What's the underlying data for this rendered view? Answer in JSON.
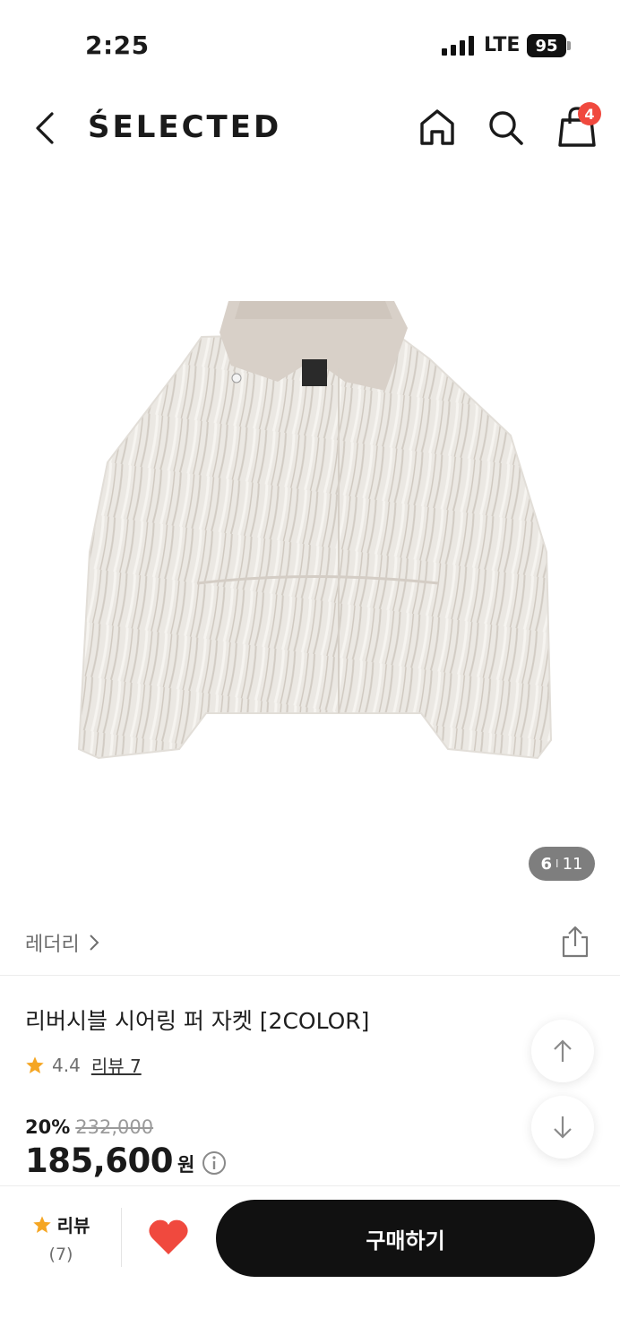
{
  "status_bar": {
    "time": "2:25",
    "network": "LTE",
    "battery": "95"
  },
  "header": {
    "brand": "ŚELECTED",
    "cart_count": "4"
  },
  "image_counter": {
    "current": "6",
    "separator": "I",
    "total": "11"
  },
  "product": {
    "brand": "레더리",
    "title": "리버시블 시어링 퍼 자켓 [2COLOR]",
    "rating": "4.4",
    "review_link": "리뷰 7",
    "discount_rate": "20%",
    "original_price": "232,000",
    "sale_price": "185,600",
    "currency": "원"
  },
  "bottom_bar": {
    "review_label": "리뷰",
    "review_count": "(7)",
    "buy_label": "구매하기"
  },
  "colors": {
    "accent": "#f0493e",
    "star": "#f5a623",
    "heart": "#f0493e",
    "button": "#111111"
  },
  "icons": [
    "back-icon",
    "home-icon",
    "search-icon",
    "shopping-bag-icon",
    "share-icon",
    "star-icon",
    "arrow-up-icon",
    "arrow-down-icon",
    "info-icon",
    "heart-icon"
  ]
}
